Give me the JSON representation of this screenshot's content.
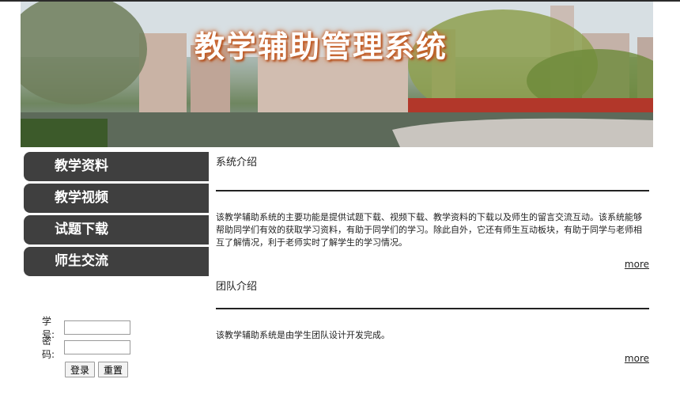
{
  "banner": {
    "title": "教学辅助管理系统"
  },
  "nav": {
    "items": [
      {
        "label": "教学资料"
      },
      {
        "label": "教学视频"
      },
      {
        "label": "试题下载"
      },
      {
        "label": "师生交流"
      }
    ]
  },
  "login": {
    "id_label": "学号:",
    "id_value": "",
    "password_label": "密码:",
    "password_value": "",
    "login_button": "登录",
    "reset_button": "重置"
  },
  "main": {
    "sections": [
      {
        "title": "系统介绍",
        "body": "该教学辅助系统的主要功能是提供试题下载、视频下载、教学资料的下载以及师生的留言交流互动。该系统能够帮助同学们有效的获取学习资料，有助于同学们的学习。除此自外，它还有师生互动板块，有助于同学与老师相互了解情况，利于老师实时了解学生的学习情况。",
        "more": "more"
      },
      {
        "title": "团队介绍",
        "body": "该教学辅助系统是由学生团队设计开发完成。",
        "more": "more"
      }
    ]
  }
}
